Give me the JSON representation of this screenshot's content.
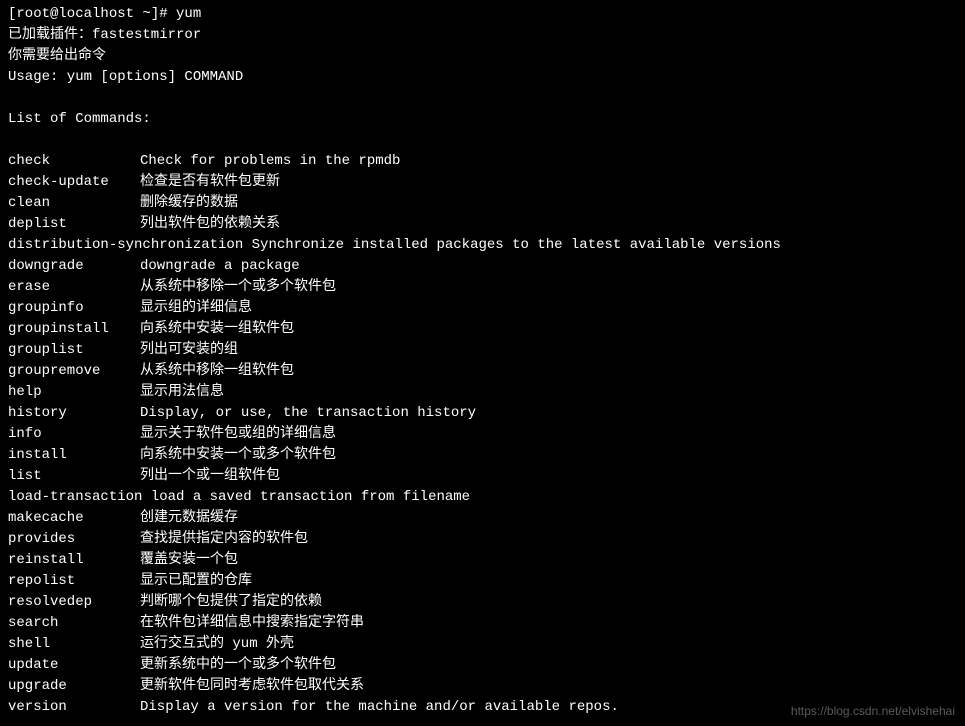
{
  "prompt": "[root@localhost ~]# yum",
  "plugin_line": "已加载插件：fastestmirror",
  "need_cmd_line": "你需要给出命令",
  "usage_line": "Usage: yum [options] COMMAND",
  "list_header": "List of Commands:",
  "commands": [
    {
      "name": "check",
      "desc": "Check for problems in the rpmdb"
    },
    {
      "name": "check-update",
      "desc": "检查是否有软件包更新"
    },
    {
      "name": "clean",
      "desc": "删除缓存的数据"
    },
    {
      "name": "deplist",
      "desc": "列出软件包的依赖关系"
    },
    {
      "name": "distribution-synchronization",
      "desc": " Synchronize installed packages to the latest available versions",
      "noSpace": true
    },
    {
      "name": "downgrade",
      "desc": "downgrade a package"
    },
    {
      "name": "erase",
      "desc": "从系统中移除一个或多个软件包"
    },
    {
      "name": "groupinfo",
      "desc": "显示组的详细信息"
    },
    {
      "name": "groupinstall",
      "desc": "向系统中安装一组软件包"
    },
    {
      "name": "grouplist",
      "desc": "列出可安装的组"
    },
    {
      "name": "groupremove",
      "desc": "从系统中移除一组软件包"
    },
    {
      "name": "help",
      "desc": "显示用法信息"
    },
    {
      "name": "history",
      "desc": "Display, or use, the transaction history"
    },
    {
      "name": "info",
      "desc": "显示关于软件包或组的详细信息"
    },
    {
      "name": "install",
      "desc": "向系统中安装一个或多个软件包"
    },
    {
      "name": "list",
      "desc": "列出一个或一组软件包"
    },
    {
      "name": "load-transaction",
      "desc": " load a saved transaction from filename",
      "noSpace": true
    },
    {
      "name": "makecache",
      "desc": "创建元数据缓存"
    },
    {
      "name": "provides",
      "desc": "查找提供指定内容的软件包"
    },
    {
      "name": "reinstall",
      "desc": "覆盖安装一个包"
    },
    {
      "name": "repolist",
      "desc": "显示已配置的仓库"
    },
    {
      "name": "resolvedep",
      "desc": "判断哪个包提供了指定的依赖"
    },
    {
      "name": "search",
      "desc": "在软件包详细信息中搜索指定字符串"
    },
    {
      "name": "shell",
      "desc": "运行交互式的 yum 外壳"
    },
    {
      "name": "update",
      "desc": "更新系统中的一个或多个软件包"
    },
    {
      "name": "upgrade",
      "desc": "更新软件包同时考虑软件包取代关系"
    },
    {
      "name": "version",
      "desc": "Display a version for the machine and/or available repos."
    }
  ],
  "watermark": "https://blog.csdn.net/elvishehai"
}
